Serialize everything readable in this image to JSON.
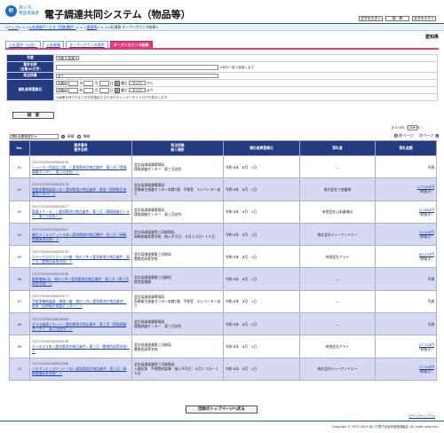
{
  "logo": {
    "mark": "e",
    "line1": "あいち",
    "line2": "物品等調達"
  },
  "title": "電子調達共同システム（物品等）",
  "header_buttons": [
    "文字を大きく",
    "標　準",
    "文字を小さく"
  ],
  "breadcrumb": {
    "items": [
      "トップ",
      "入札情報サービス（団体選択）",
      "愛知県",
      "入札情報 オープンカウンタ結果"
    ],
    "sep": " > "
  },
  "prefecture": "愛知県",
  "tabs": [
    "入札案件（公告）",
    "入札結果",
    "オープンカウンタ案件",
    "オープンカウンタ結果"
  ],
  "form": {
    "year_label": "年度",
    "year_value": "令和 6 年度",
    "case_label": "案件名称\n（全角50文字）",
    "case_note": "※部分一致で検索します。",
    "office_label": "発注所属",
    "office_value": "全て",
    "date_label": "開札結果登録日",
    "era": "令和",
    "y_unit": "年",
    "m_unit": "月",
    "d_unit": "日",
    "cal_mark": "曲",
    "day_unit": "曜日",
    "clear": "クリア",
    "from": "から",
    "to": "まで",
    "date_note": "※画像を押下すると日付を指定するためのカレンダーダイアログを表示します。",
    "search_button": "検　索"
  },
  "results": {
    "count": "全 474件（",
    "per_page": "30",
    "count_suffix": "件 ）",
    "sort_value": "開札結果登録日",
    "asc": "昇順",
    "desc": "降順",
    "prev": "前ページ",
    "next": "次ページ",
    "columns": {
      "no": "No.",
      "case": "案件番号\n案件名称",
      "office": "発注所属\n納入場所",
      "date": "開札結果登録日",
      "winner": "落札者",
      "price": "落札金額"
    },
    "rows": [
      {
        "no": "61",
        "code": "2307232300000628136",
        "name": "シューカー用部品１個　＜愛知県地方物品業件：東三河（環境調査センター　東三河支所）＞",
        "office": "会計局調達課環境局",
        "place": "環境調査センター　東三河支所",
        "date": "令和 6年　8月　1日",
        "winner": "―",
        "price": "",
        "tax": "",
        "status": "不調"
      },
      {
        "no": "62",
        "code": "2307232300000628178",
        "name": "検査用機械器具１台＜愛知県地方物品業件：尾張（医療衛生検査センター）＞",
        "office": "会計局調達課環境局",
        "place": "医療衛生検査センター本館1階　手術室　エレベーターあり",
        "date": "令和 6年　8月　1日",
        "winner": "株式会社三協器械",
        "price": "177,000円",
        "tax": "（税抜き）",
        "status": ""
      },
      {
        "no": "63",
        "code": "2307232300000628117",
        "name": "容器１ケース　＜愛知県地方物品業件：東三河（環境調査センター　東三河支所）＞",
        "office": "会計局調達課環境局",
        "place": "環境調査センター　東三河支所",
        "date": "令和 6年　8月　1日",
        "winner": "有限会社山本器械店",
        "price": "22,680円",
        "tax": "（税抜き）",
        "status": ""
      },
      {
        "no": "64",
        "code": "2307242300000628327",
        "name": "硬式テニスラケット４本＜愛知県地方物品業件：西三河（岡崎商業高等学校）＞",
        "office": "会計局調達課西三河総務局",
        "place": "岡崎商業高等学校　納入不可日：８月１３日～１５日",
        "date": "令和 6年　8月　1日",
        "winner": "株式会社ティーアンドエー",
        "price": "24,300円",
        "tax": "（税抜き）",
        "status": ""
      },
      {
        "no": "65",
        "code": "2307232300000628239",
        "name": "クイックルワイパー３０箱　他の７件＜愛知県地方物品業件：東三河（豊橋西高等学校）＞",
        "office": "会計局調達課東三河総局",
        "place": "豊橋西高等学校",
        "date": "令和 6年　8月　1日",
        "winner": "有限会社アライ",
        "price": "64,220円",
        "tax": "（税抜き）",
        "status": ""
      },
      {
        "no": "66",
        "code": "2307232300000628166",
        "name": "脂肪燃焼1台　他の１件＜愛知県地方物品業件：東三河（東三河高等学校）＞",
        "office": "会計局調達課東三河総局",
        "place": "経営管理課",
        "date": "令和 6年　8月　1日",
        "winner": "―",
        "price": "",
        "tax": "",
        "status": "不調"
      },
      {
        "no": "67",
        "code": "2307232300000628177",
        "name": "手術用機械器具・調理１箱　他の１件＜愛知県地方物品業件：尾張（医療衛生検査センター）＞",
        "office": "会計局調達課環境局",
        "place": "医療衛生検査センター本館1階　手術室　エレベーターあり",
        "date": "令和 6年　8月　1日",
        "winner": "―",
        "price": "",
        "tax": "",
        "status": "不調"
      },
      {
        "no": "68",
        "code": "2307232300000628090",
        "name": "ガラス器具２セット＜愛知県地方物品業件：東三河（環境調査センター　東三河支所）＞",
        "office": "会計局調達課環境局",
        "place": "環境調査センター　東三河支所",
        "date": "令和 6年　8月　1日",
        "winner": "―",
        "price": "",
        "tax": "",
        "status": "不調"
      },
      {
        "no": "69",
        "code": "2307232300000628238",
        "name": "ホース４０本＜愛知県地方物品業件：東三河（豊橋西高等学校）＞",
        "office": "会計局調達課東三河総局",
        "place": "豊橋西高等学校",
        "date": "令和 6年　8月　1日",
        "winner": "有限会社アライ",
        "price": "27,720円",
        "tax": "（税抜き）",
        "status": ""
      },
      {
        "no": "70",
        "code": "2307242300000628366",
        "name": "バドミントンラケット７本＜愛知県地方物品業件：西三河（岡崎商業高等学校）＞",
        "office": "会計局調達課西三河総務局",
        "place": "入間区角　手術教材倉庫　納入不可日：８月１３日～１５日",
        "date": "令和 6年　8月　1日",
        "winner": "株式会社ティーアンドエー",
        "price": "27,900円",
        "tax": "（税抜き）",
        "status": ""
      }
    ]
  },
  "top_button": "団体のトップページへ戻る",
  "page_top": "ページトップへ",
  "copyright": "Copyright © 2007-2024 あいち電子自治体推進協議会. All rights reserved."
}
